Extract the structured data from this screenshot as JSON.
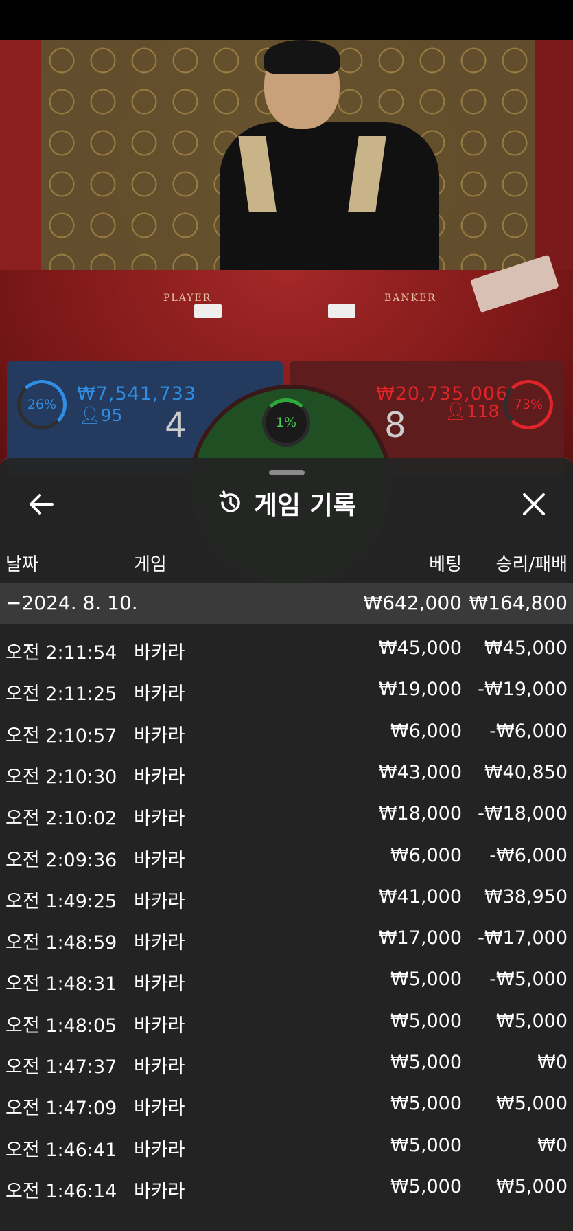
{
  "table": {
    "player_label": "PLAYER",
    "banker_label": "BANKER"
  },
  "bets": {
    "player": {
      "percent": "26%",
      "amount": "₩7,541,733",
      "players": "95",
      "score": "4"
    },
    "tie": {
      "percent": "1%"
    },
    "banker": {
      "percent": "73%",
      "amount": "₩20,735,006",
      "players": "118",
      "score": "8"
    }
  },
  "colors": {
    "player": "#2f8de3",
    "banker": "#e0242a",
    "tie": "#43c94c"
  },
  "sheet": {
    "title": "게임 기록",
    "icons": {
      "back": "arrow-left-icon",
      "history": "history-icon",
      "close": "close-icon"
    },
    "columns": {
      "date": "날짜",
      "game": "게임",
      "bet": "베팅",
      "result": "승리/패배"
    },
    "group": {
      "date": "−2024. 8. 10.",
      "bet": "₩642,000",
      "result": "₩164,800"
    },
    "rows": [
      {
        "time": "오전 2:11:54",
        "game": "바카라",
        "bet": "₩45,000",
        "result": "₩45,000"
      },
      {
        "time": "오전 2:11:25",
        "game": "바카라",
        "bet": "₩19,000",
        "result": "-₩19,000"
      },
      {
        "time": "오전 2:10:57",
        "game": "바카라",
        "bet": "₩6,000",
        "result": "-₩6,000"
      },
      {
        "time": "오전 2:10:30",
        "game": "바카라",
        "bet": "₩43,000",
        "result": "₩40,850"
      },
      {
        "time": "오전 2:10:02",
        "game": "바카라",
        "bet": "₩18,000",
        "result": "-₩18,000"
      },
      {
        "time": "오전 2:09:36",
        "game": "바카라",
        "bet": "₩6,000",
        "result": "-₩6,000"
      },
      {
        "time": "오전 1:49:25",
        "game": "바카라",
        "bet": "₩41,000",
        "result": "₩38,950"
      },
      {
        "time": "오전 1:48:59",
        "game": "바카라",
        "bet": "₩17,000",
        "result": "-₩17,000"
      },
      {
        "time": "오전 1:48:31",
        "game": "바카라",
        "bet": "₩5,000",
        "result": "-₩5,000"
      },
      {
        "time": "오전 1:48:05",
        "game": "바카라",
        "bet": "₩5,000",
        "result": "₩5,000"
      },
      {
        "time": "오전 1:47:37",
        "game": "바카라",
        "bet": "₩5,000",
        "result": "₩0"
      },
      {
        "time": "오전 1:47:09",
        "game": "바카라",
        "bet": "₩5,000",
        "result": "₩5,000"
      },
      {
        "time": "오전 1:46:41",
        "game": "바카라",
        "bet": "₩5,000",
        "result": "₩0"
      },
      {
        "time": "오전 1:46:14",
        "game": "바카라",
        "bet": "₩5,000",
        "result": "₩5,000"
      }
    ]
  }
}
